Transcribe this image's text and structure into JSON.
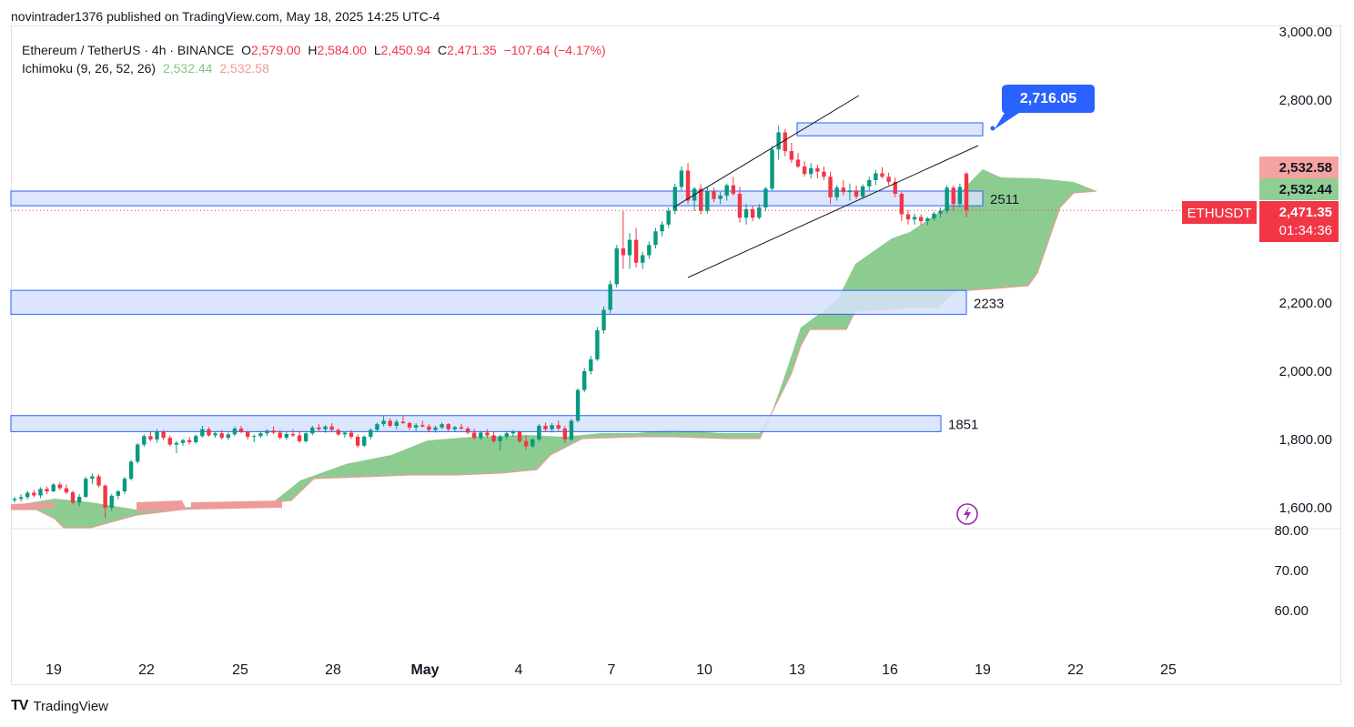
{
  "header": {
    "publish_line": "novintrader1376 published on TradingView.com, May 18, 2025 14:25 UTC-4"
  },
  "legend": {
    "symbol": "Ethereum / TetherUS · 4h · BINANCE",
    "o_label": "O",
    "o": "2,579.00",
    "h_label": "H",
    "h": "2,584.00",
    "l_label": "L",
    "l": "2,450.94",
    "c_label": "C",
    "c": "2,471.35",
    "change": "−107.64 (−4.17%)",
    "indicator": "Ichimoku (9, 26, 52, 26)",
    "ind_a": "2,532.44",
    "ind_b": "2,532.58"
  },
  "colors": {
    "up": "#089981",
    "down": "#f23645",
    "cloud_green": "#81c784",
    "cloud_red": "#ef9a9a",
    "zone_fill": "#d6e2fb",
    "zone_stroke": "#2962ff",
    "callout": "#2962ff"
  },
  "chart_data": {
    "type": "candlestick",
    "symbol": "ETHUSDT",
    "timeframe": "4h",
    "y_ticks": [
      "3,000.00",
      "2,800.00",
      "2,200.00",
      "2,000.00",
      "1,800.00",
      "1,600.00"
    ],
    "sub_y_ticks": [
      "80.00",
      "70.00",
      "60.00"
    ],
    "x_ticks": [
      "19",
      "22",
      "25",
      "28",
      "May",
      "4",
      "7",
      "10",
      "13",
      "16",
      "19",
      "22",
      "25"
    ],
    "ylim": [
      1540,
      3000
    ],
    "price_labels": {
      "ichimoku_b": "2,532.58",
      "ichimoku_a": "2,532.44",
      "last": "2,471.35",
      "countdown": "01:34:36",
      "symbol_tag": "ETHUSDT"
    },
    "zones": [
      {
        "label": "2511",
        "low": 2485,
        "high": 2528
      },
      {
        "label": "2233",
        "low": 2167,
        "high": 2237
      },
      {
        "label": "1851",
        "low": 1823,
        "high": 1870
      },
      {
        "label": "",
        "low": 2690,
        "high": 2728
      }
    ],
    "callout": "2,716.05",
    "candles_ohlc": [
      [
        1622,
        1632,
        1615,
        1626
      ],
      [
        1626,
        1640,
        1618,
        1631
      ],
      [
        1631,
        1650,
        1624,
        1644
      ],
      [
        1644,
        1652,
        1630,
        1636
      ],
      [
        1636,
        1660,
        1628,
        1655
      ],
      [
        1655,
        1662,
        1640,
        1648
      ],
      [
        1648,
        1672,
        1645,
        1668
      ],
      [
        1668,
        1675,
        1652,
        1657
      ],
      [
        1657,
        1668,
        1640,
        1645
      ],
      [
        1645,
        1650,
        1610,
        1615
      ],
      [
        1615,
        1640,
        1605,
        1632
      ],
      [
        1632,
        1690,
        1628,
        1685
      ],
      [
        1685,
        1700,
        1670,
        1692
      ],
      [
        1692,
        1698,
        1660,
        1665
      ],
      [
        1665,
        1668,
        1570,
        1600
      ],
      [
        1600,
        1640,
        1590,
        1635
      ],
      [
        1635,
        1652,
        1625,
        1648
      ],
      [
        1648,
        1690,
        1640,
        1685
      ],
      [
        1685,
        1740,
        1680,
        1735
      ],
      [
        1735,
        1790,
        1730,
        1785
      ],
      [
        1785,
        1815,
        1778,
        1810
      ],
      [
        1810,
        1825,
        1795,
        1800
      ],
      [
        1800,
        1830,
        1790,
        1822
      ],
      [
        1822,
        1828,
        1798,
        1805
      ],
      [
        1805,
        1812,
        1780,
        1785
      ],
      [
        1785,
        1795,
        1760,
        1790
      ],
      [
        1790,
        1802,
        1782,
        1798
      ],
      [
        1798,
        1808,
        1785,
        1792
      ],
      [
        1792,
        1815,
        1788,
        1810
      ],
      [
        1810,
        1840,
        1805,
        1830
      ],
      [
        1830,
        1836,
        1808,
        1812
      ],
      [
        1812,
        1822,
        1805,
        1818
      ],
      [
        1818,
        1828,
        1800,
        1805
      ],
      [
        1805,
        1820,
        1798,
        1815
      ],
      [
        1815,
        1838,
        1810,
        1832
      ],
      [
        1832,
        1840,
        1818,
        1822
      ],
      [
        1822,
        1826,
        1800,
        1808
      ],
      [
        1808,
        1815,
        1792,
        1810
      ],
      [
        1810,
        1825,
        1805,
        1818
      ],
      [
        1818,
        1830,
        1810,
        1826
      ],
      [
        1826,
        1838,
        1815,
        1820
      ],
      [
        1820,
        1828,
        1800,
        1805
      ],
      [
        1805,
        1822,
        1798,
        1816
      ],
      [
        1816,
        1830,
        1808,
        1812
      ],
      [
        1812,
        1825,
        1790,
        1795
      ],
      [
        1795,
        1822,
        1790,
        1818
      ],
      [
        1818,
        1840,
        1812,
        1835
      ],
      [
        1835,
        1845,
        1825,
        1830
      ],
      [
        1830,
        1842,
        1820,
        1838
      ],
      [
        1838,
        1848,
        1825,
        1828
      ],
      [
        1828,
        1832,
        1810,
        1815
      ],
      [
        1815,
        1824,
        1805,
        1820
      ],
      [
        1820,
        1828,
        1802,
        1808
      ],
      [
        1808,
        1815,
        1775,
        1782
      ],
      [
        1782,
        1812,
        1778,
        1808
      ],
      [
        1808,
        1832,
        1800,
        1828
      ],
      [
        1828,
        1850,
        1822,
        1845
      ],
      [
        1845,
        1868,
        1838,
        1855
      ],
      [
        1855,
        1862,
        1835,
        1840
      ],
      [
        1840,
        1858,
        1830,
        1852
      ],
      [
        1852,
        1870,
        1845,
        1848
      ],
      [
        1848,
        1852,
        1828,
        1835
      ],
      [
        1835,
        1848,
        1825,
        1842
      ],
      [
        1842,
        1855,
        1835,
        1838
      ],
      [
        1838,
        1845,
        1822,
        1828
      ],
      [
        1828,
        1840,
        1820,
        1835
      ],
      [
        1835,
        1850,
        1830,
        1845
      ],
      [
        1845,
        1848,
        1825,
        1830
      ],
      [
        1830,
        1840,
        1822,
        1836
      ],
      [
        1836,
        1846,
        1828,
        1832
      ],
      [
        1832,
        1838,
        1815,
        1820
      ],
      [
        1820,
        1832,
        1800,
        1805
      ],
      [
        1805,
        1825,
        1798,
        1820
      ],
      [
        1820,
        1830,
        1805,
        1812
      ],
      [
        1812,
        1822,
        1790,
        1795
      ],
      [
        1795,
        1815,
        1768,
        1808
      ],
      [
        1808,
        1825,
        1800,
        1818
      ],
      [
        1818,
        1828,
        1808,
        1822
      ],
      [
        1822,
        1826,
        1790,
        1795
      ],
      [
        1795,
        1810,
        1770,
        1780
      ],
      [
        1780,
        1805,
        1775,
        1800
      ],
      [
        1800,
        1845,
        1795,
        1840
      ],
      [
        1840,
        1850,
        1822,
        1830
      ],
      [
        1830,
        1848,
        1820,
        1842
      ],
      [
        1842,
        1855,
        1825,
        1832
      ],
      [
        1832,
        1840,
        1790,
        1800
      ],
      [
        1800,
        1860,
        1795,
        1855
      ],
      [
        1855,
        1950,
        1850,
        1945
      ],
      [
        1945,
        2010,
        1938,
        2000
      ],
      [
        2000,
        2045,
        1990,
        2035
      ],
      [
        2035,
        2130,
        2030,
        2120
      ],
      [
        2120,
        2190,
        2110,
        2180
      ],
      [
        2180,
        2265,
        2170,
        2255
      ],
      [
        2255,
        2370,
        2245,
        2360
      ],
      [
        2360,
        2470,
        2300,
        2340
      ],
      [
        2340,
        2405,
        2300,
        2385
      ],
      [
        2385,
        2420,
        2305,
        2318
      ],
      [
        2318,
        2350,
        2300,
        2340
      ],
      [
        2340,
        2380,
        2330,
        2370
      ],
      [
        2370,
        2420,
        2360,
        2410
      ],
      [
        2410,
        2440,
        2395,
        2430
      ],
      [
        2430,
        2480,
        2420,
        2470
      ],
      [
        2470,
        2550,
        2460,
        2540
      ],
      [
        2540,
        2600,
        2530,
        2588
      ],
      [
        2588,
        2610,
        2490,
        2500
      ],
      [
        2500,
        2540,
        2470,
        2535
      ],
      [
        2535,
        2548,
        2460,
        2470
      ],
      [
        2470,
        2540,
        2462,
        2528
      ],
      [
        2528,
        2538,
        2495,
        2505
      ],
      [
        2505,
        2525,
        2490,
        2515
      ],
      [
        2515,
        2550,
        2500,
        2545
      ],
      [
        2545,
        2570,
        2515,
        2520
      ],
      [
        2520,
        2540,
        2435,
        2450
      ],
      [
        2450,
        2490,
        2430,
        2475
      ],
      [
        2475,
        2485,
        2440,
        2450
      ],
      [
        2450,
        2490,
        2445,
        2480
      ],
      [
        2480,
        2540,
        2470,
        2535
      ],
      [
        2535,
        2660,
        2530,
        2650
      ],
      [
        2650,
        2720,
        2620,
        2700
      ],
      [
        2700,
        2710,
        2630,
        2645
      ],
      [
        2645,
        2670,
        2610,
        2620
      ],
      [
        2620,
        2640,
        2595,
        2600
      ],
      [
        2600,
        2615,
        2570,
        2578
      ],
      [
        2578,
        2610,
        2565,
        2595
      ],
      [
        2595,
        2605,
        2565,
        2585
      ],
      [
        2585,
        2600,
        2560,
        2570
      ],
      [
        2570,
        2585,
        2490,
        2510
      ],
      [
        2510,
        2545,
        2500,
        2538
      ],
      [
        2538,
        2560,
        2515,
        2525
      ],
      [
        2525,
        2550,
        2500,
        2530
      ],
      [
        2530,
        2545,
        2505,
        2512
      ],
      [
        2512,
        2548,
        2505,
        2542
      ],
      [
        2542,
        2570,
        2530,
        2560
      ],
      [
        2560,
        2590,
        2545,
        2580
      ],
      [
        2580,
        2598,
        2565,
        2570
      ],
      [
        2570,
        2582,
        2545,
        2555
      ],
      [
        2555,
        2568,
        2510,
        2520
      ],
      [
        2520,
        2525,
        2440,
        2460
      ],
      [
        2460,
        2472,
        2430,
        2445
      ],
      [
        2445,
        2462,
        2430,
        2452
      ],
      [
        2452,
        2460,
        2428,
        2440
      ],
      [
        2440,
        2452,
        2428,
        2448
      ],
      [
        2448,
        2468,
        2440,
        2462
      ],
      [
        2462,
        2480,
        2450,
        2470
      ],
      [
        2470,
        2545,
        2462,
        2538
      ],
      [
        2538,
        2545,
        2470,
        2490
      ],
      [
        2490,
        2550,
        2480,
        2540
      ],
      [
        2579,
        2584,
        2451,
        2471
      ]
    ]
  }
}
